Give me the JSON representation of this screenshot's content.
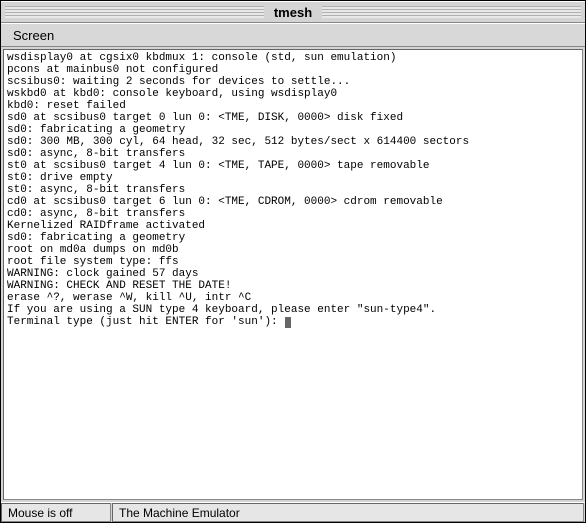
{
  "window": {
    "title": "tmesh"
  },
  "menubar": {
    "items": [
      {
        "label": "Screen"
      }
    ]
  },
  "terminal": {
    "lines": [
      "wsdisplay0 at cgsix0 kbdmux 1: console (std, sun emulation)",
      "pcons at mainbus0 not configured",
      "scsibus0: waiting 2 seconds for devices to settle...",
      "wskbd0 at kbd0: console keyboard, using wsdisplay0",
      "kbd0: reset failed",
      "sd0 at scsibus0 target 0 lun 0: <TME, DISK, 0000> disk fixed",
      "sd0: fabricating a geometry",
      "sd0: 300 MB, 300 cyl, 64 head, 32 sec, 512 bytes/sect x 614400 sectors",
      "sd0: async, 8-bit transfers",
      "st0 at scsibus0 target 4 lun 0: <TME, TAPE, 0000> tape removable",
      "st0: drive empty",
      "st0: async, 8-bit transfers",
      "cd0 at scsibus0 target 6 lun 0: <TME, CDROM, 0000> cdrom removable",
      "cd0: async, 8-bit transfers",
      "Kernelized RAIDframe activated",
      "sd0: fabricating a geometry",
      "root on md0a dumps on md0b",
      "root file system type: ffs",
      "WARNING: clock gained 57 days",
      "WARNING: CHECK AND RESET THE DATE!",
      "erase ^?, werase ^W, kill ^U, intr ^C",
      "",
      "If you are using a SUN type 4 keyboard, please enter \"sun-type4\".",
      "Terminal type (just hit ENTER for 'sun'): "
    ]
  },
  "statusbar": {
    "mouse": "Mouse is off",
    "label": "The Machine Emulator"
  }
}
